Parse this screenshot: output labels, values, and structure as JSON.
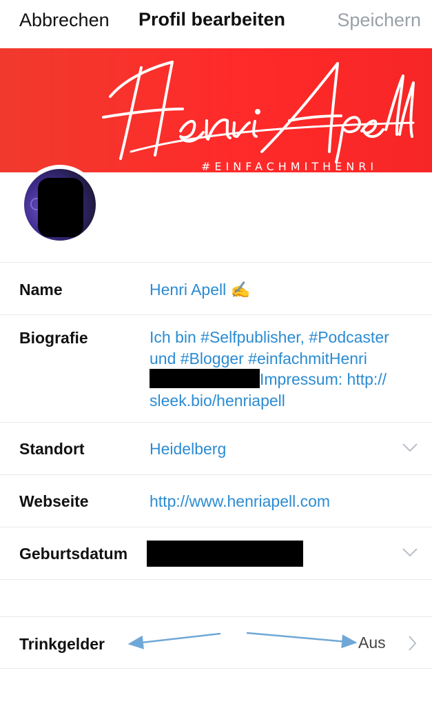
{
  "header": {
    "cancel_label": "Abbrechen",
    "title": "Profil bearbeiten",
    "save_label": "Speichern"
  },
  "banner": {
    "logo_text": "Henri Apell",
    "hashtag": "#EINFACHMITHENRI",
    "color": "#f72e2a"
  },
  "fields": {
    "name": {
      "label": "Name",
      "value": "Henri Apell ✍️"
    },
    "bio": {
      "label": "Biografie",
      "lines": [
        "Ich bin #Selfpublisher, #Podcaster",
        "und #Blogger #einfachmitHenri",
        "Impressum: http://",
        "sleek.bio/henriapell"
      ]
    },
    "location": {
      "label": "Standort",
      "value": "Heidelberg"
    },
    "website": {
      "label": "Webseite",
      "value": "http://www.henriapell.com"
    },
    "birthdate": {
      "label": "Geburtsdatum",
      "value": ""
    },
    "tips": {
      "label": "Trinkgelder",
      "value": "Aus"
    }
  },
  "colors": {
    "link": "#2b8bd2",
    "annotation_arrow": "#6fa7d6",
    "divider": "#e6e9ec"
  },
  "icons": {
    "location_chevron": "chevron-down-icon",
    "birthdate_chevron": "chevron-down-icon",
    "tips_chevron": "chevron-right-icon"
  }
}
